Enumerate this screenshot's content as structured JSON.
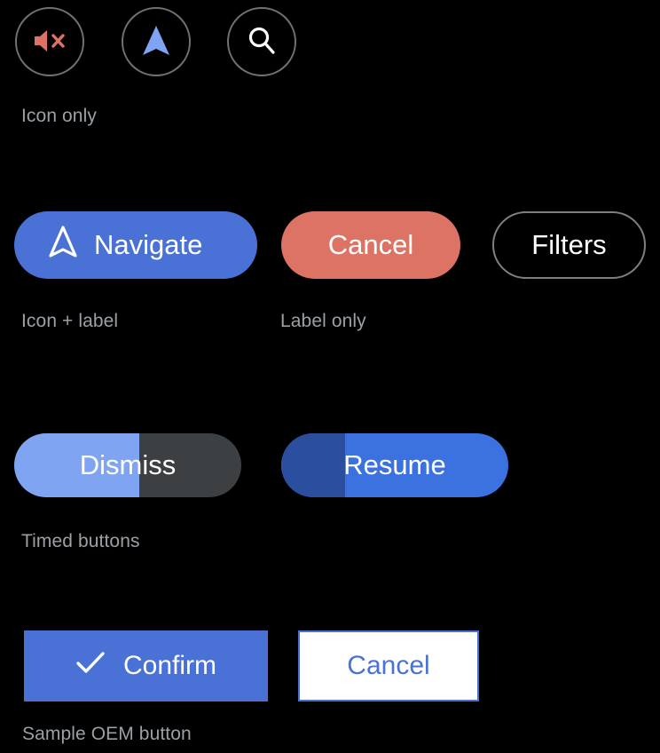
{
  "theme": {
    "background": "#000000",
    "accent_blue": "#4a72d6",
    "accent_blue_light": "#7fa4f2",
    "accent_blue_dark": "#2b4f9e",
    "accent_red": "#dd7365",
    "outline_gray": "#7c8084",
    "caption_gray": "#9aa0a6",
    "track_gray": "#3c4043",
    "white": "#ffffff"
  },
  "sections": [
    {
      "caption": "Icon only",
      "buttons": [
        {
          "name": "mute-button",
          "icon": "volume-off-icon",
          "icon_color": "#dd7365"
        },
        {
          "name": "navigate-button",
          "icon": "navigation-arrow-icon",
          "icon_color": "#7fa4f2"
        },
        {
          "name": "search-button",
          "icon": "search-icon",
          "icon_color": "#ffffff"
        }
      ]
    },
    {
      "caption": "Icon + label",
      "caption_secondary": "Label only",
      "buttons": [
        {
          "name": "navigate-labeled-button",
          "label": "Navigate",
          "icon": "navigation-arrow-outline-icon",
          "fill": "#4a72d6",
          "text_color": "#ffffff"
        },
        {
          "name": "cancel-pill-button",
          "label": "Cancel",
          "fill": "#dd7365",
          "text_color": "#ffffff"
        },
        {
          "name": "filters-button",
          "label": "Filters",
          "fill": "#000000",
          "border": "#7c8084",
          "text_color": "#ffffff"
        }
      ]
    },
    {
      "caption": "Timed buttons",
      "buttons": [
        {
          "name": "dismiss-timed-button",
          "label": "Dismiss",
          "progress_percent": 55,
          "fill": "#7fa4f2",
          "track": "#3c4043",
          "text_color": "#ffffff"
        },
        {
          "name": "resume-timed-button",
          "label": "Resume",
          "progress_percent": 28,
          "fill": "#2b4f9e",
          "track": "#3b72e0",
          "text_color": "#ffffff"
        }
      ]
    },
    {
      "caption": "Sample OEM button",
      "buttons": [
        {
          "name": "confirm-oem-button",
          "label": "Confirm",
          "icon": "check-icon",
          "fill": "#4a72d6",
          "text_color": "#ffffff"
        },
        {
          "name": "cancel-oem-button",
          "label": "Cancel",
          "fill": "#ffffff",
          "border": "#4a72d6",
          "text_color": "#4a72d6"
        }
      ]
    }
  ],
  "labels": {
    "icon_only": "Icon only",
    "icon_plus_label": "Icon + label",
    "label_only": "Label only",
    "timed_buttons": "Timed buttons",
    "sample_oem_button": "Sample OEM button",
    "navigate": "Navigate",
    "cancel": "Cancel",
    "filters": "Filters",
    "dismiss": "Dismiss",
    "resume": "Resume",
    "confirm": "Confirm",
    "oem_cancel": "Cancel"
  }
}
